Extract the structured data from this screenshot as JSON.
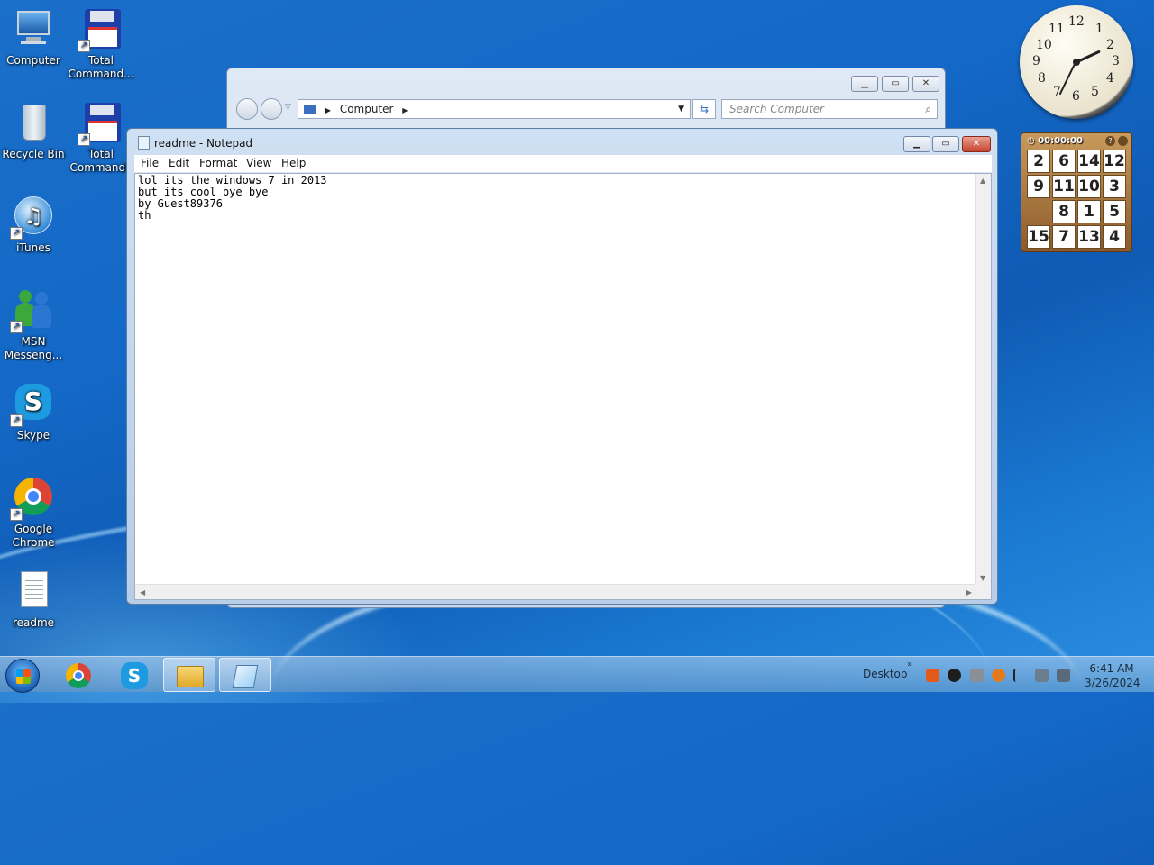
{
  "desktop_icons": [
    {
      "label": "Computer"
    },
    {
      "label": "Total Command..."
    },
    {
      "label": "Recycle Bin"
    },
    {
      "label": "Total Commande"
    },
    {
      "label": "iTunes"
    },
    {
      "label": "MSN Messeng..."
    },
    {
      "label": "Skype"
    },
    {
      "label": "Google Chrome"
    },
    {
      "label": "readme"
    }
  ],
  "explorer": {
    "address": "Computer",
    "search_placeholder": "Search Computer"
  },
  "notepad": {
    "title": "readme - Notepad",
    "menu": [
      "File",
      "Edit",
      "Format",
      "View",
      "Help"
    ],
    "content": "lol its the windows 7 in 2013\nbut its cool bye bye\nby Guest89376\nth"
  },
  "puzzle": {
    "timer": "00:00:00",
    "tiles": [
      "2",
      "6",
      "14",
      "12",
      "9",
      "11",
      "10",
      "3",
      "",
      "8",
      "1",
      "5",
      "15",
      "7",
      "13",
      "4"
    ]
  },
  "clock": {
    "numbers": [
      "12",
      "1",
      "2",
      "3",
      "4",
      "5",
      "6",
      "7",
      "8",
      "9",
      "10",
      "11"
    ]
  },
  "taskbar": {
    "desktop_label": "Desktop",
    "time": "6:41 AM",
    "date": "3/26/2024"
  }
}
